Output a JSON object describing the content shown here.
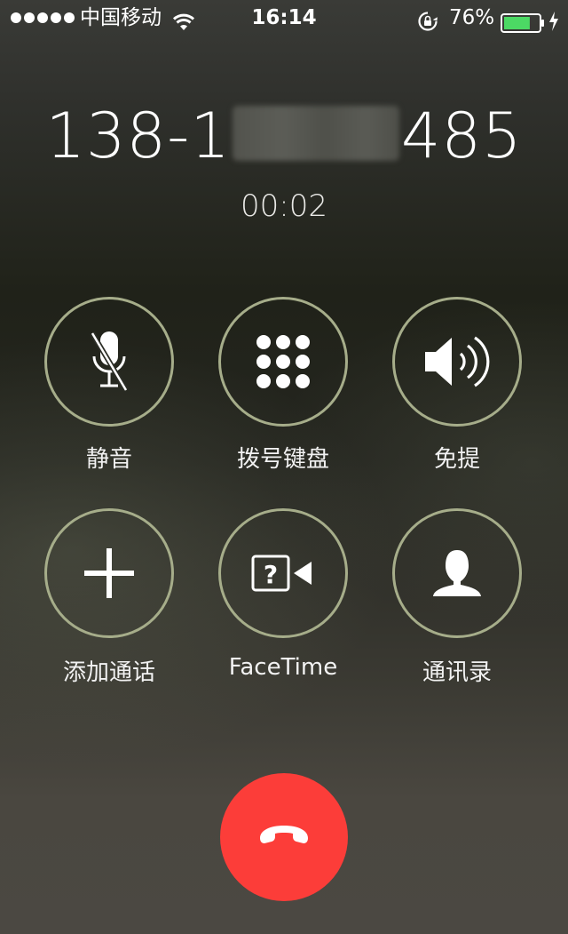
{
  "status_bar": {
    "carrier": "中国移动",
    "time": "16:14",
    "battery_percent": "76%",
    "battery_level": 0.76,
    "signal_dots": 5,
    "icons": [
      "wifi-icon",
      "rotation-lock-icon",
      "battery-icon",
      "charging-icon"
    ]
  },
  "call": {
    "number_prefix": "138-1",
    "number_suffix": "485",
    "duration": "00:02"
  },
  "buttons": [
    {
      "label": "静音",
      "icon": "muted-microphone-icon"
    },
    {
      "label": "拨号键盘",
      "icon": "keypad-icon"
    },
    {
      "label": "免提",
      "icon": "speaker-icon"
    },
    {
      "label": "添加通话",
      "icon": "plus-icon"
    },
    {
      "label": "FaceTime",
      "icon": "facetime-icon"
    },
    {
      "label": "通讯录",
      "icon": "contacts-icon"
    }
  ],
  "end_call": {
    "icon": "hang-up-icon"
  },
  "colors": {
    "ring": "#a6ad8a",
    "end_call": "#fc3d39",
    "battery_fill": "#4cd964"
  }
}
